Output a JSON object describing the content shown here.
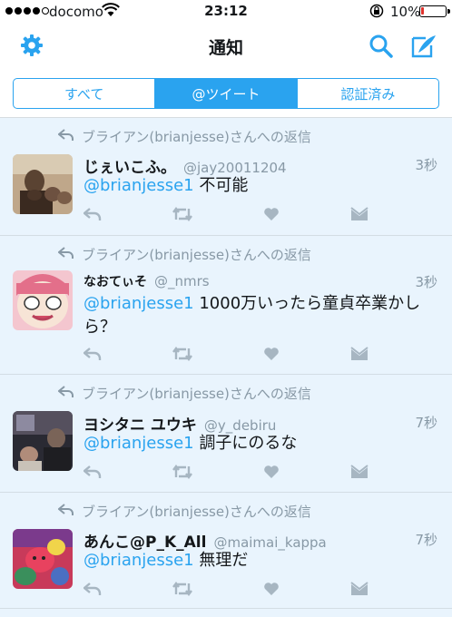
{
  "status_bar": {
    "carrier": "docomo",
    "time": "23:12",
    "battery_text": "10%",
    "battery_level": 0.1,
    "battery_color": "#e0312b"
  },
  "nav": {
    "title": "通知"
  },
  "tabs": [
    {
      "label": "すべて",
      "active": false
    },
    {
      "label": "@ツイート",
      "active": true
    },
    {
      "label": "認証済み",
      "active": false
    }
  ],
  "accent_color": "#2aa3ef",
  "tweets": [
    {
      "reply_context": "ブライアン(brianjesse)さんへの返信",
      "name": "じぇいこふ。",
      "handle": "@jay20011204",
      "time": "3秒",
      "mention": "@brianjesse1",
      "text_line1": " 不可能",
      "text_line2": ""
    },
    {
      "reply_context": "ブライアン(brianjesse)さんへの返信",
      "name": "なおてぃそ",
      "handle": "@_nmrs",
      "time": "3秒",
      "mention": "@brianjesse1",
      "text_line1": " 1000万いったら童貞卒業かし",
      "text_line2": "ら？"
    },
    {
      "reply_context": "ブライアン(brianjesse)さんへの返信",
      "name": "ヨシタニ ユウキ",
      "handle": "@y_debiru",
      "time": "7秒",
      "mention": "@brianjesse1",
      "text_line1": " 調子にのるな",
      "text_line2": ""
    },
    {
      "reply_context": "ブライアン(brianjesse)さんへの返信",
      "name": "あんこ@P_K_All",
      "handle": "@maimai_kappa",
      "time": "7秒",
      "mention": "@brianjesse1",
      "text_line1": " 無理だ",
      "text_line2": ""
    }
  ]
}
